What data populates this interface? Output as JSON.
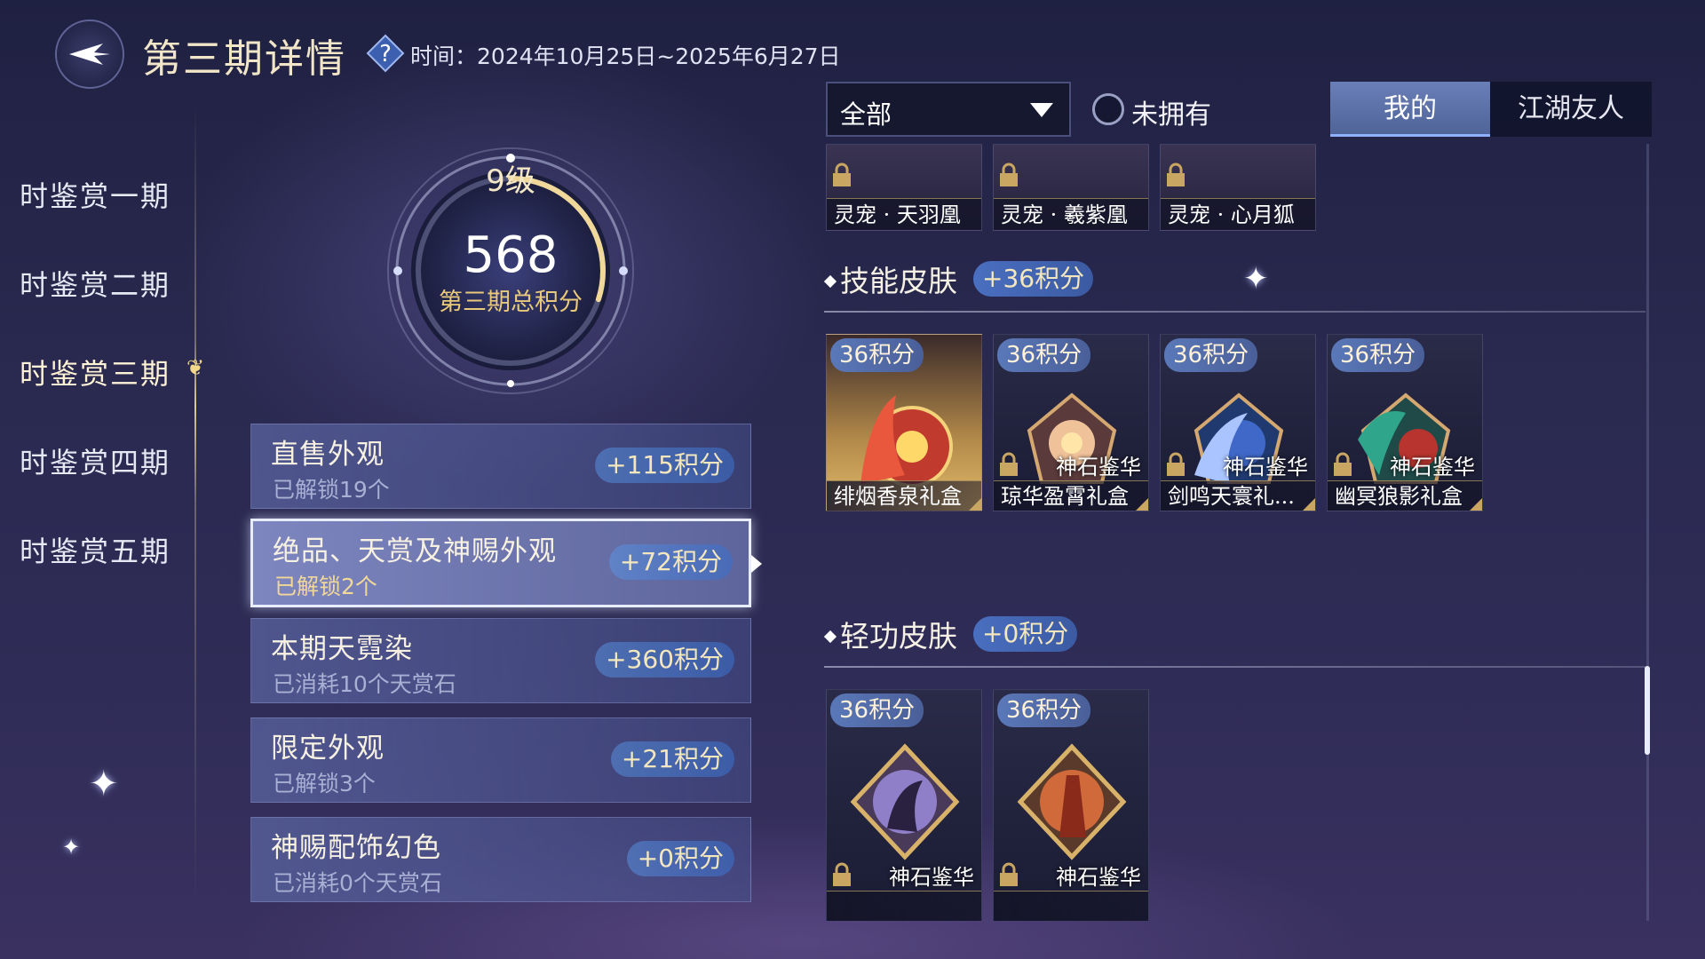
{
  "header": {
    "title": "第三期详情",
    "period_label": "时间：",
    "period_range": "2024年10月25日~2025年6月27日"
  },
  "nav": {
    "items": [
      {
        "label": "时鉴赏一期"
      },
      {
        "label": "时鉴赏二期"
      },
      {
        "label": "时鉴赏三期"
      },
      {
        "label": "时鉴赏四期"
      },
      {
        "label": "时鉴赏五期"
      }
    ],
    "active_index": 2
  },
  "score": {
    "level": "9级",
    "total": "568",
    "label": "第三期总积分",
    "level_progress": 0.3
  },
  "categories": [
    {
      "title": "直售外观",
      "sub": "已解锁19个",
      "points": "+115积分"
    },
    {
      "title": "绝品、天赏及神赐外观",
      "sub": "已解锁2个",
      "points": "+72积分"
    },
    {
      "title": "本期天霓染",
      "sub": "已消耗10个天赏石",
      "points": "+360积分"
    },
    {
      "title": "限定外观",
      "sub": "已解锁3个",
      "points": "+21积分"
    },
    {
      "title": "神赐配饰幻色",
      "sub": "已消耗0个天赏石",
      "points": "+0积分"
    }
  ],
  "filter": {
    "select_value": "全部",
    "unowned_label": "未拥有",
    "unowned_checked": false,
    "tabs": [
      {
        "label": "我的",
        "active": true
      },
      {
        "label": "江湖友人",
        "active": false
      }
    ]
  },
  "pets": [
    {
      "name": "灵宠 · 天羽凰",
      "icon": "lock-icon"
    },
    {
      "name": "灵宠 · 羲紫凰",
      "icon": "lock-icon"
    },
    {
      "name": "灵宠 · 心月狐",
      "icon": "lock-icon"
    }
  ],
  "skill_section": {
    "title": "技能皮肤",
    "points": "+36积分",
    "items": [
      {
        "badge": "36积分",
        "tag": "",
        "name": "绯烟香泉礼盒",
        "owned": true,
        "color": "#d8543a"
      },
      {
        "badge": "36积分",
        "tag": "神石鉴华",
        "name": "琼华盈霄礼盒",
        "owned": false,
        "color": "#e0a080"
      },
      {
        "badge": "36积分",
        "tag": "神石鉴华",
        "name": "剑鸣天寰礼...",
        "owned": false,
        "color": "#5c86d8"
      },
      {
        "badge": "36积分",
        "tag": "神石鉴华",
        "name": "幽冥狼影礼盒",
        "owned": false,
        "color": "#3aa08a"
      }
    ]
  },
  "qinggong_section": {
    "title": "轻功皮肤",
    "points": "+0积分",
    "items": [
      {
        "badge": "36积分",
        "tag": "神石鉴华",
        "name": "",
        "owned": false,
        "color": "#8f7fc8"
      },
      {
        "badge": "36积分",
        "tag": "神石鉴华",
        "name": "",
        "owned": false,
        "color": "#d06a3a"
      }
    ]
  },
  "colors": {
    "accent_gold": "#e9c97a",
    "points_blue": "#4a6fc0",
    "tab_active": "#6a7fb8"
  }
}
